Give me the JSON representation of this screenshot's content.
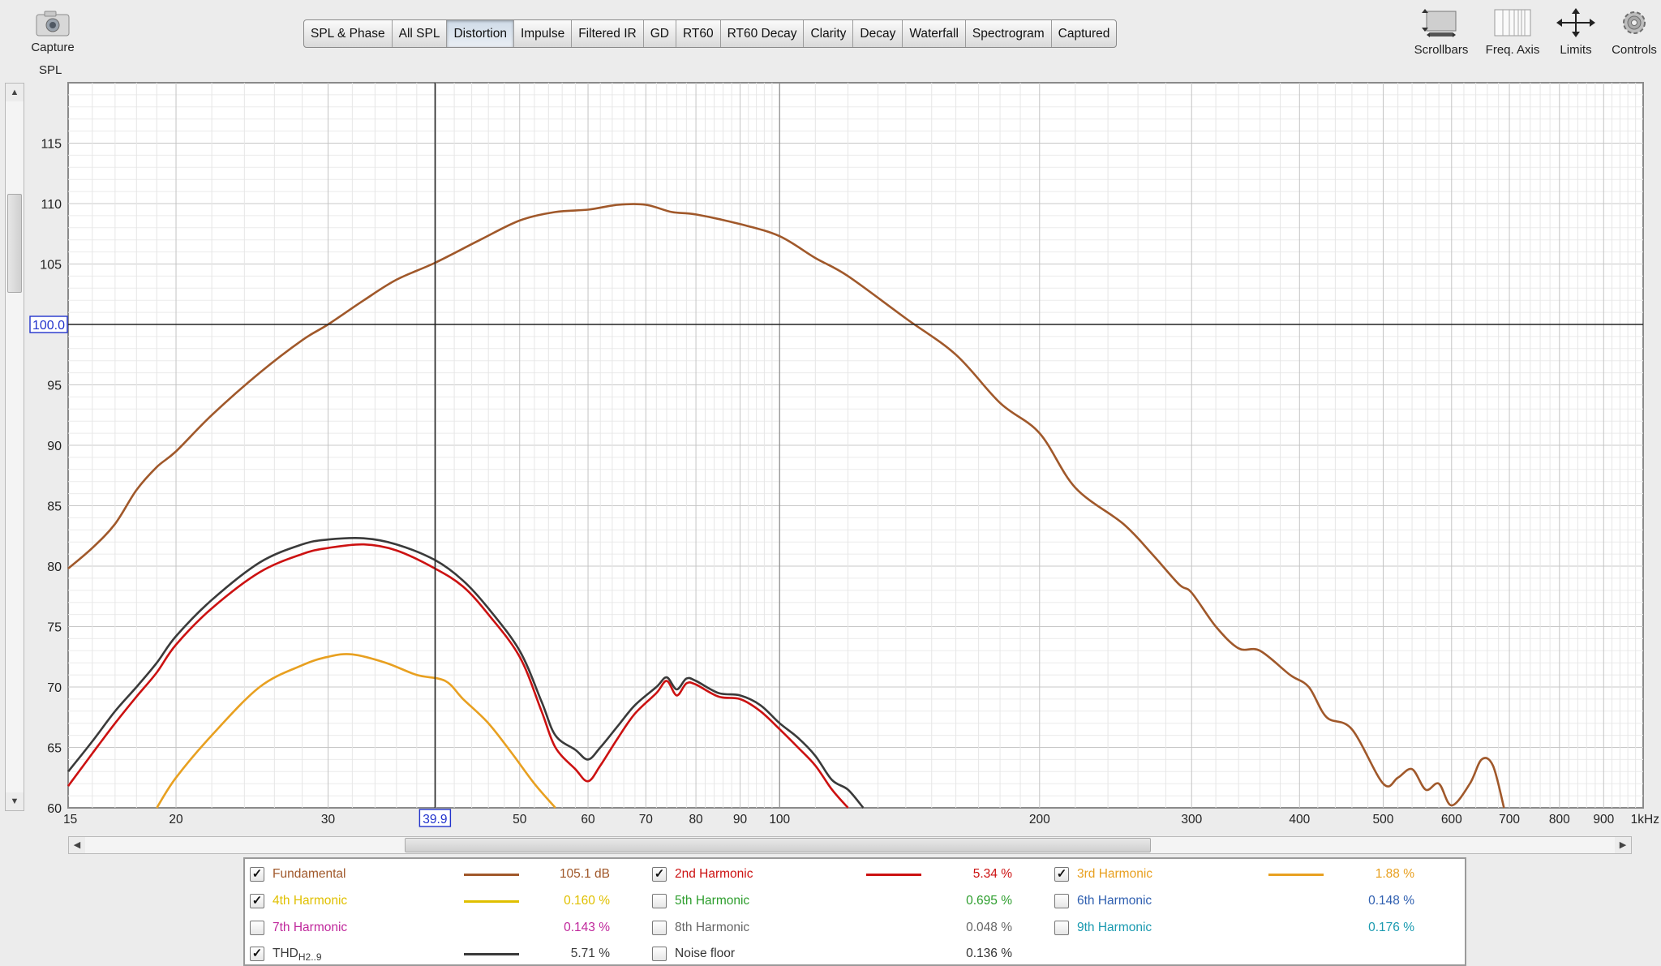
{
  "toolbar": {
    "capture_label": "Capture",
    "tabs": [
      "SPL & Phase",
      "All SPL",
      "Distortion",
      "Impulse",
      "Filtered IR",
      "GD",
      "RT60",
      "RT60 Decay",
      "Clarity",
      "Decay",
      "Waterfall",
      "Spectrogram",
      "Captured"
    ],
    "active_tab": "Distortion",
    "tools": [
      {
        "label": "Scrollbars",
        "icon": "scrollbars-icon"
      },
      {
        "label": "Freq. Axis",
        "icon": "freq-axis-icon"
      },
      {
        "label": "Limits",
        "icon": "limits-icon"
      },
      {
        "label": "Controls",
        "icon": "gear-icon"
      }
    ]
  },
  "plot": {
    "y_axis_label": "SPL",
    "cursor_y_readout": "100.0",
    "cursor_x_readout": "39.9"
  },
  "chart_data": {
    "type": "line",
    "ylabel": "SPL",
    "xscale": "log",
    "xlim": [
      15,
      1000
    ],
    "ylim": [
      60,
      120
    ],
    "grid": true,
    "y_ticks": [
      60,
      65,
      70,
      75,
      80,
      85,
      90,
      95,
      100,
      105,
      110,
      115
    ],
    "x_ticks": [
      {
        "value": 15,
        "label": "15"
      },
      {
        "value": 20,
        "label": "20"
      },
      {
        "value": 30,
        "label": "30"
      },
      {
        "value": 50,
        "label": "50"
      },
      {
        "value": 60,
        "label": "60"
      },
      {
        "value": 70,
        "label": "70"
      },
      {
        "value": 80,
        "label": "80"
      },
      {
        "value": 90,
        "label": "90"
      },
      {
        "value": 100,
        "label": "100"
      },
      {
        "value": 200,
        "label": "200"
      },
      {
        "value": 300,
        "label": "300"
      },
      {
        "value": 400,
        "label": "400"
      },
      {
        "value": 500,
        "label": "500"
      },
      {
        "value": 600,
        "label": "600"
      },
      {
        "value": 700,
        "label": "700"
      },
      {
        "value": 800,
        "label": "800"
      },
      {
        "value": 900,
        "label": "900"
      },
      {
        "value": 1000,
        "label": "1kHz"
      }
    ],
    "cursor": {
      "x": 39.9,
      "y": 100.0
    },
    "series": [
      {
        "name": "Fundamental",
        "color": "#a0582a",
        "points": [
          [
            15,
            79.8
          ],
          [
            16,
            81.5
          ],
          [
            17,
            83.5
          ],
          [
            18,
            86.3
          ],
          [
            19,
            88.2
          ],
          [
            20,
            89.5
          ],
          [
            22,
            92.5
          ],
          [
            25,
            96.0
          ],
          [
            28,
            98.7
          ],
          [
            30,
            100.0
          ],
          [
            33,
            102.0
          ],
          [
            36,
            103.7
          ],
          [
            39.9,
            105.1
          ],
          [
            45,
            107.0
          ],
          [
            50,
            108.6
          ],
          [
            55,
            109.3
          ],
          [
            60,
            109.5
          ],
          [
            65,
            109.9
          ],
          [
            70,
            109.9
          ],
          [
            75,
            109.3
          ],
          [
            80,
            109.1
          ],
          [
            90,
            108.3
          ],
          [
            100,
            107.3
          ],
          [
            110,
            105.5
          ],
          [
            120,
            104.0
          ],
          [
            140,
            100.5
          ],
          [
            160,
            97.5
          ],
          [
            180,
            93.5
          ],
          [
            200,
            91.0
          ],
          [
            220,
            86.5
          ],
          [
            250,
            83.5
          ],
          [
            270,
            81.0
          ],
          [
            290,
            78.5
          ],
          [
            300,
            77.8
          ],
          [
            320,
            75.0
          ],
          [
            340,
            73.2
          ],
          [
            360,
            73.0
          ],
          [
            390,
            71.0
          ],
          [
            410,
            70.0
          ],
          [
            430,
            67.5
          ],
          [
            460,
            66.5
          ],
          [
            500,
            62.0
          ],
          [
            520,
            62.5
          ],
          [
            540,
            63.2
          ],
          [
            560,
            61.5
          ],
          [
            580,
            62.0
          ],
          [
            600,
            60.2
          ],
          [
            630,
            62.0
          ],
          [
            650,
            64.0
          ],
          [
            670,
            63.5
          ],
          [
            690,
            60.0
          ]
        ]
      },
      {
        "name": "2nd Harmonic",
        "color": "#cc1111",
        "points": [
          [
            15,
            61.8
          ],
          [
            16,
            64.5
          ],
          [
            17,
            67.0
          ],
          [
            18,
            69.2
          ],
          [
            19,
            71.2
          ],
          [
            20,
            73.5
          ],
          [
            22,
            76.5
          ],
          [
            25,
            79.5
          ],
          [
            28,
            81.0
          ],
          [
            30,
            81.5
          ],
          [
            33,
            81.8
          ],
          [
            36,
            81.3
          ],
          [
            39.9,
            79.8
          ],
          [
            43,
            78.3
          ],
          [
            46,
            76.0
          ],
          [
            50,
            72.5
          ],
          [
            53,
            68.0
          ],
          [
            55,
            65.0
          ],
          [
            58,
            63.2
          ],
          [
            60,
            62.2
          ],
          [
            62,
            63.5
          ],
          [
            65,
            65.8
          ],
          [
            68,
            67.8
          ],
          [
            72,
            69.5
          ],
          [
            74,
            70.5
          ],
          [
            76,
            69.3
          ],
          [
            78,
            70.3
          ],
          [
            80,
            70.2
          ],
          [
            85,
            69.2
          ],
          [
            90,
            69.0
          ],
          [
            95,
            68.0
          ],
          [
            100,
            66.5
          ],
          [
            105,
            65.0
          ],
          [
            110,
            63.5
          ],
          [
            115,
            61.5
          ],
          [
            120,
            60.0
          ]
        ]
      },
      {
        "name": "3rd Harmonic",
        "color": "#e8a020",
        "points": [
          [
            19,
            60.0
          ],
          [
            20,
            62.5
          ],
          [
            22,
            66.0
          ],
          [
            25,
            70.0
          ],
          [
            28,
            71.8
          ],
          [
            30,
            72.5
          ],
          [
            32,
            72.7
          ],
          [
            35,
            72.0
          ],
          [
            38,
            71.0
          ],
          [
            41,
            70.5
          ],
          [
            43,
            69.0
          ],
          [
            46,
            67.0
          ],
          [
            49,
            64.5
          ],
          [
            52,
            62.0
          ],
          [
            55,
            60.0
          ]
        ]
      },
      {
        "name": "THD H2..9",
        "color": "#3a3a3a",
        "points": [
          [
            15,
            63.0
          ],
          [
            16,
            65.5
          ],
          [
            17,
            68.0
          ],
          [
            18,
            70.0
          ],
          [
            19,
            72.0
          ],
          [
            20,
            74.2
          ],
          [
            22,
            77.2
          ],
          [
            25,
            80.3
          ],
          [
            28,
            81.8
          ],
          [
            30,
            82.2
          ],
          [
            33,
            82.3
          ],
          [
            36,
            81.8
          ],
          [
            39.9,
            80.5
          ],
          [
            43,
            78.8
          ],
          [
            46,
            76.5
          ],
          [
            50,
            73.0
          ],
          [
            53,
            68.8
          ],
          [
            55,
            66.0
          ],
          [
            58,
            64.8
          ],
          [
            60,
            64.0
          ],
          [
            62,
            65.0
          ],
          [
            65,
            66.8
          ],
          [
            68,
            68.5
          ],
          [
            72,
            70.0
          ],
          [
            74,
            70.8
          ],
          [
            76,
            69.8
          ],
          [
            78,
            70.7
          ],
          [
            80,
            70.5
          ],
          [
            85,
            69.5
          ],
          [
            90,
            69.3
          ],
          [
            95,
            68.5
          ],
          [
            100,
            67.0
          ],
          [
            105,
            65.8
          ],
          [
            110,
            64.3
          ],
          [
            115,
            62.3
          ],
          [
            120,
            61.5
          ],
          [
            125,
            60.0
          ]
        ]
      }
    ]
  },
  "legend": [
    {
      "name": "Fundamental",
      "checked": true,
      "color": "#a0582a",
      "value": "105.1 dB",
      "show_line": true,
      "col": 0,
      "row": 0
    },
    {
      "name": "2nd Harmonic",
      "checked": true,
      "color": "#cc1111",
      "value": "5.34 %",
      "show_line": true,
      "col": 1,
      "row": 0
    },
    {
      "name": "3rd Harmonic",
      "checked": true,
      "color": "#e8a020",
      "value": "1.88 %",
      "show_line": true,
      "col": 2,
      "row": 0
    },
    {
      "name": "4th Harmonic",
      "checked": true,
      "color": "#e0c000",
      "value": "0.160 %",
      "show_line": true,
      "col": 0,
      "row": 1
    },
    {
      "name": "5th Harmonic",
      "checked": false,
      "color": "#2e9e2e",
      "value": "0.695 %",
      "show_line": false,
      "col": 1,
      "row": 1
    },
    {
      "name": "6th Harmonic",
      "checked": false,
      "color": "#2f5fb0",
      "value": "0.148 %",
      "show_line": false,
      "col": 2,
      "row": 1
    },
    {
      "name": "7th Harmonic",
      "checked": false,
      "color": "#c0289c",
      "value": "0.143 %",
      "show_line": false,
      "col": 0,
      "row": 2
    },
    {
      "name": "8th Harmonic",
      "checked": false,
      "color": "#666666",
      "value": "0.048 %",
      "show_line": false,
      "col": 1,
      "row": 2
    },
    {
      "name": "9th Harmonic",
      "checked": false,
      "color": "#1a9ab0",
      "value": "0.176 %",
      "show_line": false,
      "col": 2,
      "row": 2
    },
    {
      "name": "THD",
      "sub": "H2..9",
      "checked": true,
      "color": "#3a3a3a",
      "value": "5.71 %",
      "show_line": true,
      "col": 0,
      "row": 3
    },
    {
      "name": "Noise floor",
      "checked": false,
      "color": "#333333",
      "value": "0.136 %",
      "show_line": false,
      "col": 1,
      "row": 3
    }
  ]
}
